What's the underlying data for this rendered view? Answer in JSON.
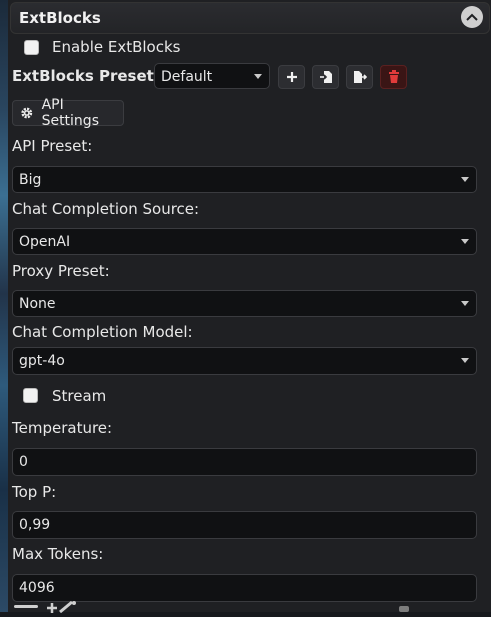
{
  "header": {
    "title": "ExtBlocks"
  },
  "enable": {
    "label": "Enable ExtBlocks",
    "checked": false
  },
  "preset": {
    "label": "ExtBlocks Preset:",
    "value": "Default"
  },
  "api_button": {
    "label": "API Settings"
  },
  "fields": {
    "api_preset": {
      "label": "API Preset:",
      "value": "Big"
    },
    "source": {
      "label": "Chat Completion Source:",
      "value": "OpenAI"
    },
    "proxy": {
      "label": "Proxy Preset:",
      "value": "None"
    },
    "model": {
      "label": "Chat Completion Model:",
      "value": "gpt-4o"
    }
  },
  "stream": {
    "label": "Stream",
    "checked": false
  },
  "temperature": {
    "label": "Temperature:",
    "value": "0"
  },
  "top_p": {
    "label": "Top P:",
    "value": "0,99"
  },
  "max_tokens": {
    "label": "Max Tokens:",
    "value": "4096"
  },
  "icons": {
    "collapse": "chevron-up-icon",
    "add": "plus-icon",
    "import": "import-icon",
    "export": "export-icon",
    "delete": "trash-icon",
    "settings": "gear-icon"
  }
}
